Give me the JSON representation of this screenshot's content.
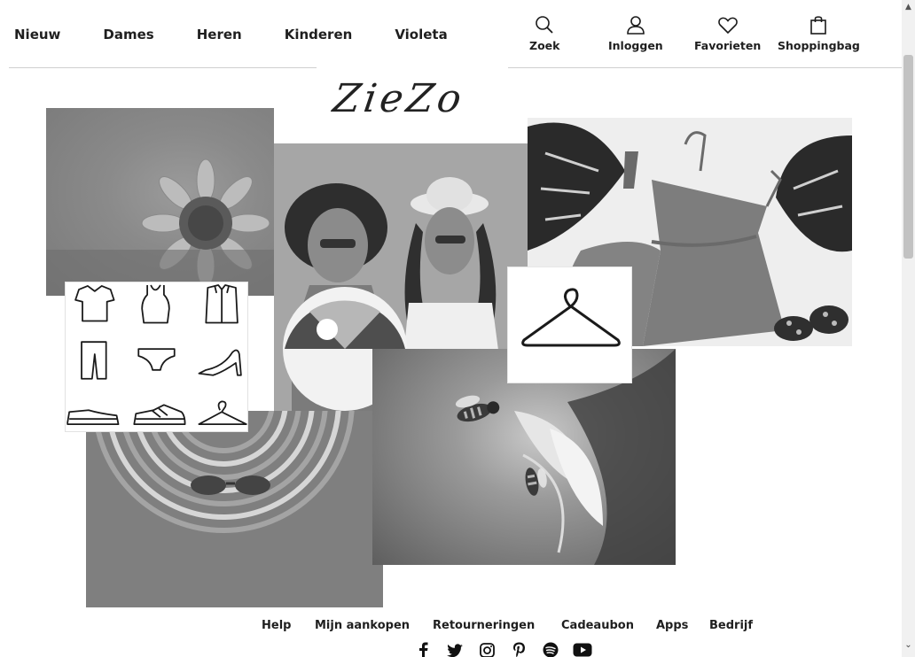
{
  "nav": {
    "items": [
      {
        "label": "Nieuw"
      },
      {
        "label": "Dames"
      },
      {
        "label": "Heren"
      },
      {
        "label": "Kinderen"
      },
      {
        "label": "Violeta"
      }
    ]
  },
  "utility": {
    "search": {
      "label": "Zoek",
      "icon": "search-icon"
    },
    "login": {
      "label": "Inloggen",
      "icon": "user-icon"
    },
    "favorites": {
      "label": "Favorieten",
      "icon": "heart-icon"
    },
    "bag": {
      "label": "Shoppingbag",
      "icon": "shopping-bag-icon"
    }
  },
  "logo": {
    "text": "ZieZo"
  },
  "collage": {
    "tiles": [
      {
        "name": "sunflower-photo"
      },
      {
        "name": "women-beach-ball-photo"
      },
      {
        "name": "dress-flatlay-photo"
      },
      {
        "name": "clothing-icons-grid"
      },
      {
        "name": "hat-sunglasses-photo"
      },
      {
        "name": "bee-flower-photo"
      },
      {
        "name": "hanger-icon-tile"
      }
    ],
    "icon_grid": [
      "t-shirt-icon",
      "tank-top-icon",
      "shirt-icon",
      "trousers-icon",
      "underwear-icon",
      "high-heel-icon",
      "dress-shoe-icon",
      "sneaker-icon",
      "hanger-icon"
    ]
  },
  "footer": {
    "links": [
      {
        "label": "Help"
      },
      {
        "label": "Mijn aankopen"
      },
      {
        "label": "Retourneringen"
      },
      {
        "label": "Cadeaubon"
      },
      {
        "label": "Apps"
      },
      {
        "label": "Bedrijf"
      }
    ],
    "social": [
      "facebook-icon",
      "twitter-icon",
      "instagram-icon",
      "pinterest-icon",
      "spotify-icon",
      "youtube-icon"
    ]
  },
  "colors": {
    "text": "#1f1f1f",
    "divider": "#cfcfcf",
    "background": "#ffffff"
  }
}
